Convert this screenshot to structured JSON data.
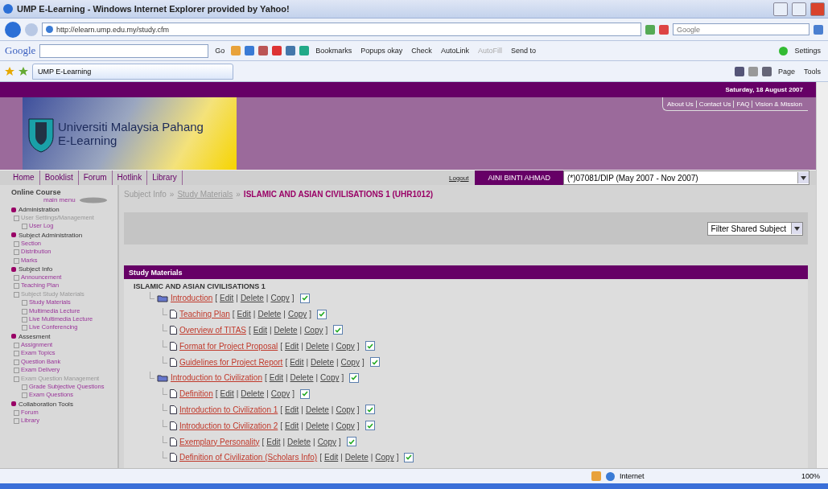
{
  "window": {
    "title": "UMP E-Learning - Windows Internet Explorer provided by Yahoo!"
  },
  "address_bar": {
    "url": "http://elearn.ump.edu.my/study.cfm",
    "search_placeholder": "Google"
  },
  "google_toolbar": {
    "logo": "Google",
    "go": "Go",
    "settings": "Settings",
    "buttons": [
      {
        "label": "Bookmarks",
        "disabled": false
      },
      {
        "label": "Popups okay",
        "disabled": false
      },
      {
        "label": "Check",
        "disabled": false
      },
      {
        "label": "AutoLink",
        "disabled": false
      },
      {
        "label": "AutoFill",
        "disabled": true
      },
      {
        "label": "Send to",
        "disabled": false
      }
    ]
  },
  "tabs": [
    {
      "label": "UMP E-Learning",
      "selected": true
    }
  ],
  "command_bar": [
    "Page",
    "Tools"
  ],
  "page": {
    "date": "Saturday, 18 August 2007",
    "top_links": [
      "About Us",
      "Contact Us",
      "FAQ",
      "Vision & Mission"
    ],
    "logo_lines": [
      "Universiti Malaysia Pahang",
      "E-Learning"
    ],
    "nav": [
      "Home",
      "Booklist",
      "Forum",
      "Hotlink",
      "Library"
    ],
    "logout": "Logout",
    "user": "AINI BINTI AHMAD",
    "session": "(*)07081/DIP (May 2007 - Nov 2007)",
    "breadcrumb": {
      "items": [
        {
          "label": "Subject Info",
          "linked": false
        },
        {
          "label": "Study Materials",
          "linked": true
        }
      ],
      "separator": "»",
      "current": "ISLAMIC AND ASIAN CIVILISATIONS 1 (UHR1012)"
    },
    "filter": "Filter Shared Subject",
    "panel_title": "Study Materials",
    "subject": "ISLAMIC AND ASIAN CIVILISATIONS 1",
    "action_marks": [
      "[",
      "|",
      "]"
    ],
    "tree": [
      {
        "title": "Introduction",
        "kind": "folder",
        "checked": true,
        "actions": [
          "Edit",
          "Delete",
          "Copy"
        ],
        "children": [
          {
            "title": "Teaching Plan",
            "kind": "document",
            "checked": true,
            "actions": [
              "Edit",
              "Delete",
              "Copy"
            ]
          },
          {
            "title": "Overview of TITAS",
            "kind": "document",
            "checked": true,
            "actions": [
              "Edit",
              "Delete",
              "Copy"
            ]
          },
          {
            "title": "Format for Project Proposal",
            "kind": "document",
            "checked": true,
            "actions": [
              "Edit",
              "Delete",
              "Copy"
            ]
          },
          {
            "title": "Guidelines for Project Report",
            "kind": "document",
            "checked": true,
            "actions": [
              "Edit",
              "Delete",
              "Copy"
            ]
          }
        ]
      },
      {
        "title": "Introduction to Civilization",
        "kind": "folder",
        "checked": true,
        "actions": [
          "Edit",
          "Delete",
          "Copy"
        ],
        "children": [
          {
            "title": "Definition",
            "kind": "document",
            "checked": true,
            "actions": [
              "Edit",
              "Delete",
              "Copy"
            ]
          },
          {
            "title": "Introduction to Civilization 1",
            "kind": "document",
            "checked": true,
            "actions": [
              "Edit",
              "Delete",
              "Copy"
            ]
          },
          {
            "title": "Introduction to Civilization 2",
            "kind": "document",
            "checked": true,
            "actions": [
              "Edit",
              "Delete",
              "Copy"
            ]
          },
          {
            "title": "Exemplary Personality",
            "kind": "document",
            "checked": true,
            "actions": [
              "Edit",
              "Delete",
              "Copy"
            ]
          },
          {
            "title": "Definition of Civilization (Scholars Info)",
            "kind": "document",
            "checked": true,
            "actions": [
              "Edit",
              "Delete",
              "Copy"
            ]
          }
        ]
      }
    ]
  },
  "sidebar": {
    "title": "Online Course",
    "subtitle": "main menu",
    "sections": [
      {
        "label": "Administration",
        "items": [
          {
            "label": "User Settings/Management",
            "linked": false,
            "children": [
              {
                "label": "User Log",
                "linked": true
              }
            ]
          }
        ]
      },
      {
        "label": "Subject Administration",
        "items": [
          {
            "label": "Section",
            "linked": true
          },
          {
            "label": "Distribution",
            "linked": true
          },
          {
            "label": "Marks",
            "linked": true
          }
        ]
      },
      {
        "label": "Subject Info",
        "items": [
          {
            "label": "Announcement",
            "linked": true
          },
          {
            "label": "Teaching Plan",
            "linked": true
          },
          {
            "label": "Subject Study Materials",
            "linked": false,
            "children": [
              {
                "label": "Study Materials",
                "linked": true
              },
              {
                "label": "Multimedia Lecture",
                "linked": true
              },
              {
                "label": "Live Multimedia Lecture",
                "linked": true
              },
              {
                "label": "Live Conferencing",
                "linked": true
              }
            ]
          }
        ]
      },
      {
        "label": "Assesment",
        "items": [
          {
            "label": "Assignment",
            "linked": true
          },
          {
            "label": "Exam Topics",
            "linked": true
          },
          {
            "label": "Question Bank",
            "linked": true
          },
          {
            "label": "Exam Delivery",
            "linked": true
          },
          {
            "label": "Exam Question Management",
            "linked": false,
            "children": [
              {
                "label": "Grade Subjective Questions",
                "linked": true
              },
              {
                "label": "Exam Questions",
                "linked": true
              }
            ]
          }
        ]
      },
      {
        "label": "Collaboration Tools",
        "items": [
          {
            "label": "Forum",
            "linked": true
          },
          {
            "label": "Library",
            "linked": true
          }
        ]
      }
    ]
  },
  "status_bar": {
    "zone": "Internet",
    "zoom": "100%"
  }
}
